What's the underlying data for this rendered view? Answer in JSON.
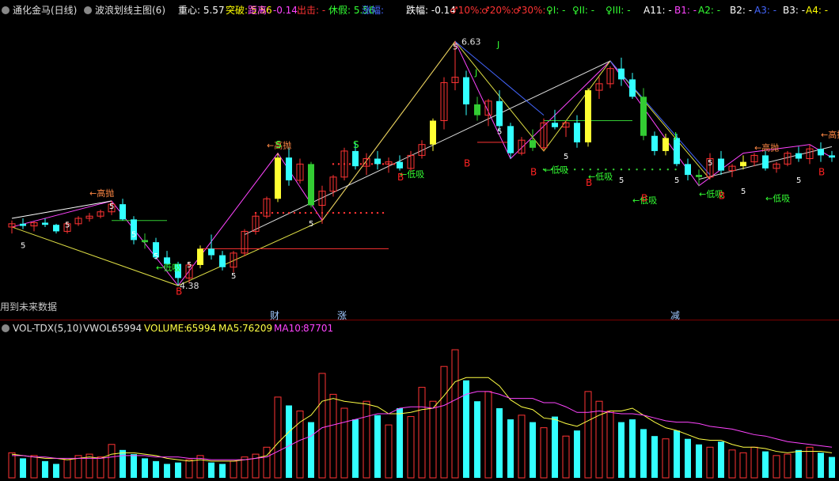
{
  "header": {
    "stock_name": "通化金马(日线)",
    "indicator_name": "波浪划线主图(6)",
    "items": [
      {
        "label": "重心:",
        "value": "5.57",
        "color": "#ffffff"
      },
      {
        "label": "突破:",
        "value": "5.56",
        "color": "#ffff00"
      },
      {
        "label": "距离:",
        "value": "-0.14",
        "color": "#ff44ff"
      },
      {
        "label": "出击:",
        "value": "-",
        "color": "#ff3333"
      },
      {
        "label": "休假:",
        "value": "5.56",
        "color": "#33ff33"
      },
      {
        "label": "涨幅:",
        "value": "",
        "color": "#4466ff"
      },
      {
        "label": "跌幅:",
        "value": "-0.14",
        "color": "#ffffff"
      },
      {
        "label": "♂10%:",
        "value": "-",
        "color": "#ff3333"
      },
      {
        "label": "♂20%:",
        "value": "-",
        "color": "#ff3333"
      },
      {
        "label": "♂30%:",
        "value": "-",
        "color": "#ff3333"
      },
      {
        "label": "♀I:",
        "value": "-",
        "color": "#33ff33"
      },
      {
        "label": "♀II:",
        "value": "-",
        "color": "#33ff33"
      },
      {
        "label": "♀III:",
        "value": "-",
        "color": "#33ff33"
      },
      {
        "label": "A11:",
        "value": "-",
        "color": "#ffffff"
      },
      {
        "label": "B1:",
        "value": "-",
        "color": "#ff44ff"
      },
      {
        "label": "A2:",
        "value": "-",
        "color": "#33ff33"
      },
      {
        "label": "B2:",
        "value": "-",
        "color": "#ffffff"
      },
      {
        "label": "A3:",
        "value": "-",
        "color": "#4466ff"
      },
      {
        "label": "B3:",
        "value": "-",
        "color": "#ffffff"
      },
      {
        "label": "A4:",
        "value": "-",
        "color": "#ffff00"
      }
    ]
  },
  "volume_header": {
    "name": "VOL-TDX(5,10)",
    "vwol_label": "VWOL:",
    "vwol_value": "65994",
    "volume_label": "VOLUME:",
    "volume_value": "65994",
    "ma5_label": "MA5:",
    "ma5_value": "76209",
    "ma10_label": "MA10:",
    "ma10_value": "87701"
  },
  "annotations": {
    "high_price": "6.63",
    "low_price": "4.38",
    "future_data_note": "用到未来数据",
    "marker_cai": "财",
    "marker_zhangfu": "涨",
    "marker_jian": "减",
    "sell_label": "高抛",
    "buy_label": "低吸",
    "b_label": "B",
    "s_label": "S",
    "j_label": "J"
  },
  "chart_data": {
    "type": "candlestick",
    "x_count": 75,
    "ylim": [
      4.3,
      6.72
    ],
    "candles": [
      [
        4.92,
        4.98,
        4.86,
        4.95
      ],
      [
        4.95,
        5.0,
        4.9,
        4.93
      ],
      [
        4.93,
        4.97,
        4.88,
        4.96
      ],
      [
        4.96,
        5.0,
        4.92,
        4.94
      ],
      [
        4.94,
        4.95,
        4.86,
        4.88
      ],
      [
        4.88,
        4.97,
        4.86,
        4.95
      ],
      [
        4.95,
        5.02,
        4.93,
        5.0
      ],
      [
        5.0,
        5.05,
        4.97,
        5.02
      ],
      [
        5.02,
        5.08,
        5.0,
        5.06
      ],
      [
        5.06,
        5.16,
        5.03,
        5.13
      ],
      [
        5.13,
        5.18,
        4.98,
        4.99
      ],
      [
        4.99,
        5.02,
        4.76,
        4.8
      ],
      [
        4.8,
        4.86,
        4.72,
        4.78
      ],
      [
        4.78,
        4.82,
        4.62,
        4.64
      ],
      [
        4.64,
        4.7,
        4.55,
        4.58
      ],
      [
        4.58,
        4.6,
        4.38,
        4.45
      ],
      [
        4.45,
        4.6,
        4.4,
        4.57
      ],
      [
        4.57,
        4.75,
        4.54,
        4.72
      ],
      [
        4.72,
        4.85,
        4.62,
        4.66
      ],
      [
        4.66,
        4.7,
        4.52,
        4.55
      ],
      [
        4.55,
        4.7,
        4.5,
        4.68
      ],
      [
        4.68,
        4.9,
        4.65,
        4.88
      ],
      [
        4.88,
        5.05,
        4.85,
        5.02
      ],
      [
        5.02,
        5.2,
        5.0,
        5.18
      ],
      [
        5.18,
        5.6,
        5.15,
        5.56
      ],
      [
        5.56,
        5.65,
        5.3,
        5.35
      ],
      [
        5.35,
        5.55,
        5.32,
        5.5
      ],
      [
        5.5,
        5.52,
        5.1,
        5.12
      ],
      [
        5.12,
        5.3,
        4.95,
        5.25
      ],
      [
        5.25,
        5.4,
        5.2,
        5.38
      ],
      [
        5.38,
        5.65,
        5.35,
        5.62
      ],
      [
        5.62,
        5.7,
        5.45,
        5.48
      ],
      [
        5.48,
        5.6,
        5.4,
        5.55
      ],
      [
        5.55,
        5.62,
        5.45,
        5.5
      ],
      [
        5.5,
        5.56,
        5.42,
        5.52
      ],
      [
        5.52,
        5.58,
        5.44,
        5.46
      ],
      [
        5.46,
        5.62,
        5.42,
        5.58
      ],
      [
        5.58,
        5.72,
        5.55,
        5.68
      ],
      [
        5.68,
        5.92,
        5.62,
        5.9
      ],
      [
        5.9,
        6.3,
        5.82,
        6.25
      ],
      [
        6.25,
        6.63,
        6.18,
        6.3
      ],
      [
        6.3,
        6.36,
        5.95,
        6.05
      ],
      [
        6.05,
        6.12,
        5.9,
        5.95
      ],
      [
        5.95,
        6.1,
        5.85,
        6.08
      ],
      [
        6.08,
        6.18,
        5.8,
        5.85
      ],
      [
        5.85,
        5.88,
        5.55,
        5.6
      ],
      [
        5.6,
        5.75,
        5.58,
        5.72
      ],
      [
        5.72,
        5.82,
        5.62,
        5.65
      ],
      [
        5.65,
        5.92,
        5.62,
        5.88
      ],
      [
        5.88,
        6.0,
        5.82,
        5.84
      ],
      [
        5.84,
        5.9,
        5.75,
        5.88
      ],
      [
        5.88,
        5.95,
        5.65,
        5.7
      ],
      [
        5.7,
        6.2,
        5.66,
        6.18
      ],
      [
        6.18,
        6.3,
        6.1,
        6.24
      ],
      [
        6.24,
        6.4,
        6.2,
        6.38
      ],
      [
        6.38,
        6.48,
        6.22,
        6.28
      ],
      [
        6.28,
        6.34,
        6.1,
        6.12
      ],
      [
        6.12,
        6.2,
        5.72,
        5.76
      ],
      [
        5.76,
        5.8,
        5.58,
        5.62
      ],
      [
        5.62,
        5.78,
        5.58,
        5.74
      ],
      [
        5.74,
        5.78,
        5.48,
        5.5
      ],
      [
        5.5,
        5.55,
        5.35,
        5.4
      ],
      [
        5.4,
        5.45,
        5.3,
        5.38
      ],
      [
        5.38,
        5.6,
        5.36,
        5.55
      ],
      [
        5.55,
        5.62,
        5.4,
        5.44
      ],
      [
        5.44,
        5.5,
        5.38,
        5.48
      ],
      [
        5.48,
        5.58,
        5.45,
        5.52
      ],
      [
        5.52,
        5.6,
        5.48,
        5.58
      ],
      [
        5.58,
        5.62,
        5.44,
        5.46
      ],
      [
        5.46,
        5.52,
        5.42,
        5.5
      ],
      [
        5.5,
        5.62,
        5.48,
        5.6
      ],
      [
        5.6,
        5.66,
        5.52,
        5.55
      ],
      [
        5.55,
        5.68,
        5.5,
        5.64
      ],
      [
        5.64,
        5.7,
        5.52,
        5.58
      ],
      [
        5.58,
        5.62,
        5.52,
        5.56
      ]
    ],
    "volume": [
      18,
      14,
      16,
      12,
      10,
      13,
      16,
      17,
      15,
      24,
      20,
      17,
      14,
      12,
      10,
      11,
      13,
      16,
      11,
      10,
      12,
      15,
      17,
      22,
      58,
      52,
      48,
      40,
      75,
      60,
      50,
      42,
      55,
      45,
      38,
      50,
      44,
      65,
      55,
      80,
      92,
      70,
      55,
      62,
      50,
      42,
      45,
      40,
      36,
      44,
      30,
      34,
      62,
      55,
      48,
      40,
      42,
      35,
      30,
      28,
      34,
      28,
      24,
      22,
      26,
      20,
      18,
      22,
      19,
      16,
      17,
      20,
      22,
      18,
      15
    ],
    "ma5": [
      17,
      16,
      15,
      14,
      14,
      13,
      14,
      15,
      14,
      17,
      18,
      18,
      17,
      16,
      14,
      13,
      12,
      13,
      12,
      12,
      12,
      13,
      14,
      16,
      25,
      33,
      40,
      45,
      55,
      57,
      55,
      54,
      53,
      51,
      46,
      46,
      47,
      49,
      50,
      59,
      69,
      72,
      72,
      72,
      66,
      56,
      51,
      49,
      43,
      42,
      39,
      37,
      41,
      45,
      48,
      48,
      50,
      45,
      40,
      36,
      34,
      31,
      28,
      27,
      27,
      24,
      22,
      22,
      21,
      19,
      18,
      19,
      19,
      19,
      18
    ],
    "ma10": [
      16,
      16,
      15,
      15,
      14,
      14,
      14,
      14,
      14,
      15,
      16,
      16,
      16,
      15,
      15,
      15,
      14,
      14,
      13,
      13,
      13,
      13,
      14,
      15,
      19,
      23,
      27,
      30,
      36,
      38,
      40,
      42,
      44,
      46,
      46,
      50,
      51,
      51,
      50,
      52,
      56,
      60,
      62,
      62,
      60,
      57,
      57,
      57,
      54,
      54,
      51,
      47,
      47,
      48,
      47,
      46,
      46,
      45,
      43,
      41,
      40,
      40,
      39,
      37,
      36,
      35,
      33,
      31,
      30,
      28,
      26,
      25,
      24,
      23,
      22
    ],
    "volume_ylim": [
      0,
      100
    ]
  }
}
